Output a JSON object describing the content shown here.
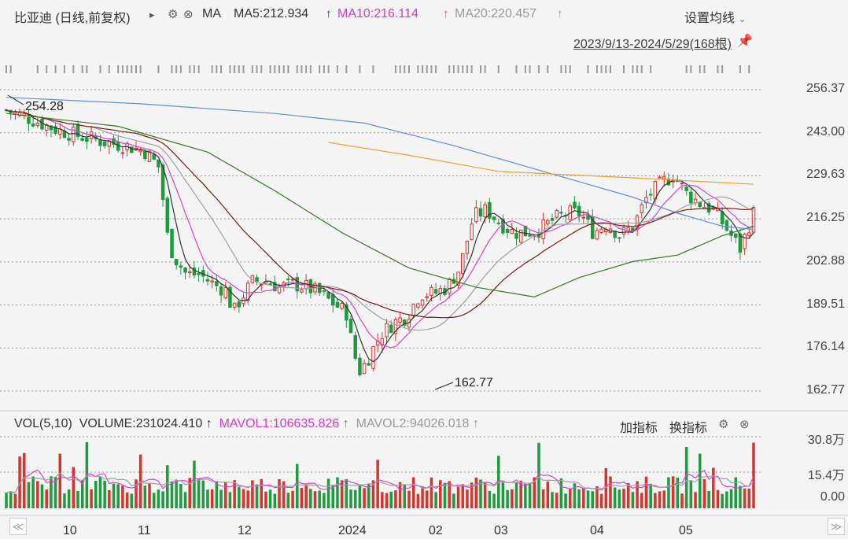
{
  "header": {
    "title": "比亚迪 (日线,前复权)",
    "arrow": "▸",
    "ma_label": "MA",
    "ma5": "MA5:212.934",
    "ma10": "MA10:216.114",
    "ma20": "MA20:220.457",
    "up_arrow": "↑",
    "settings_label": "设置均线",
    "range": "2023/9/13-2024/5/29(168根)"
  },
  "price_axis": [
    "256.37",
    "243.00",
    "229.63",
    "216.25",
    "202.88",
    "189.51",
    "176.14",
    "162.77"
  ],
  "annotations": {
    "high": "254.28",
    "low": "162.77"
  },
  "volume": {
    "label": "VOL(5,10)",
    "volume_value": "VOLUME:231024.410",
    "mavol1": "MAVOL1:106635.826",
    "mavol2": "MAVOL2:94026.018",
    "add_indicator": "加指标",
    "switch_indicator": "换指标",
    "axis": [
      "30.8万",
      "15.4万",
      "0.00"
    ]
  },
  "time_axis": [
    "10",
    "11",
    "12",
    "2024",
    "02",
    "03",
    "04",
    "05"
  ],
  "colors": {
    "up": "#d9342b",
    "down": "#1f9a3e",
    "ma5": "#333333",
    "ma10": "#e040d0",
    "ma20": "#a0a0a0",
    "ma30": "#7a1a10",
    "ma60": "#2e7d1e",
    "ma120": "#5a8fd6",
    "ma250": "#f0a030"
  },
  "chart_data": {
    "type": "candlestick",
    "ylim": [
      162.77,
      256.37
    ],
    "ma_lines": {
      "ma120": [
        [
          0,
          254
        ],
        [
          30,
          252
        ],
        [
          60,
          249
        ],
        [
          80,
          246
        ],
        [
          100,
          239
        ],
        [
          120,
          231
        ],
        [
          140,
          223
        ],
        [
          150,
          218
        ],
        [
          160,
          214
        ],
        [
          167,
          213
        ]
      ],
      "ma250": [
        [
          72,
          240
        ],
        [
          90,
          236
        ],
        [
          110,
          231
        ],
        [
          140,
          229
        ],
        [
          167,
          227
        ]
      ],
      "ma60": [
        [
          0,
          249
        ],
        [
          25,
          245
        ],
        [
          45,
          237
        ],
        [
          60,
          225
        ],
        [
          75,
          212
        ],
        [
          90,
          201
        ],
        [
          105,
          195
        ],
        [
          118,
          192
        ],
        [
          128,
          198
        ],
        [
          140,
          203
        ],
        [
          150,
          205
        ],
        [
          160,
          211
        ],
        [
          167,
          214
        ]
      ]
    }
  }
}
